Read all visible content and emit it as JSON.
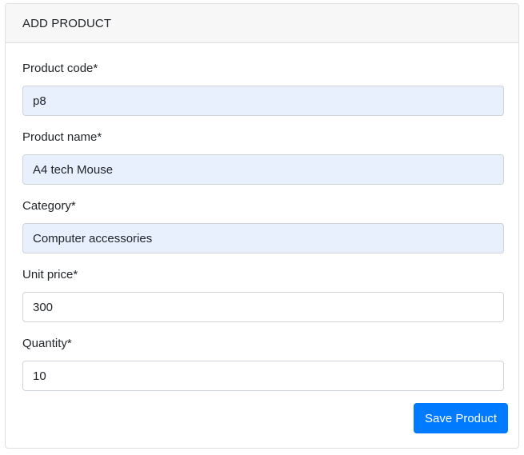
{
  "card": {
    "title": "ADD PRODUCT"
  },
  "form": {
    "fields": [
      {
        "label": "Product code*",
        "value": "p8",
        "autofilled": true
      },
      {
        "label": "Product name*",
        "value": "A4 tech Mouse",
        "autofilled": true
      },
      {
        "label": "Category*",
        "value": "Computer accessories",
        "autofilled": true
      },
      {
        "label": "Unit price*",
        "value": "300",
        "autofilled": false
      },
      {
        "label": "Quantity*",
        "value": "10",
        "autofilled": false
      }
    ],
    "submit_label": "Save Product"
  },
  "colors": {
    "primary": "#007bff",
    "autofill_bg": "#e8f0fe",
    "header_bg": "#f7f7f7",
    "border": "#ced4da"
  }
}
